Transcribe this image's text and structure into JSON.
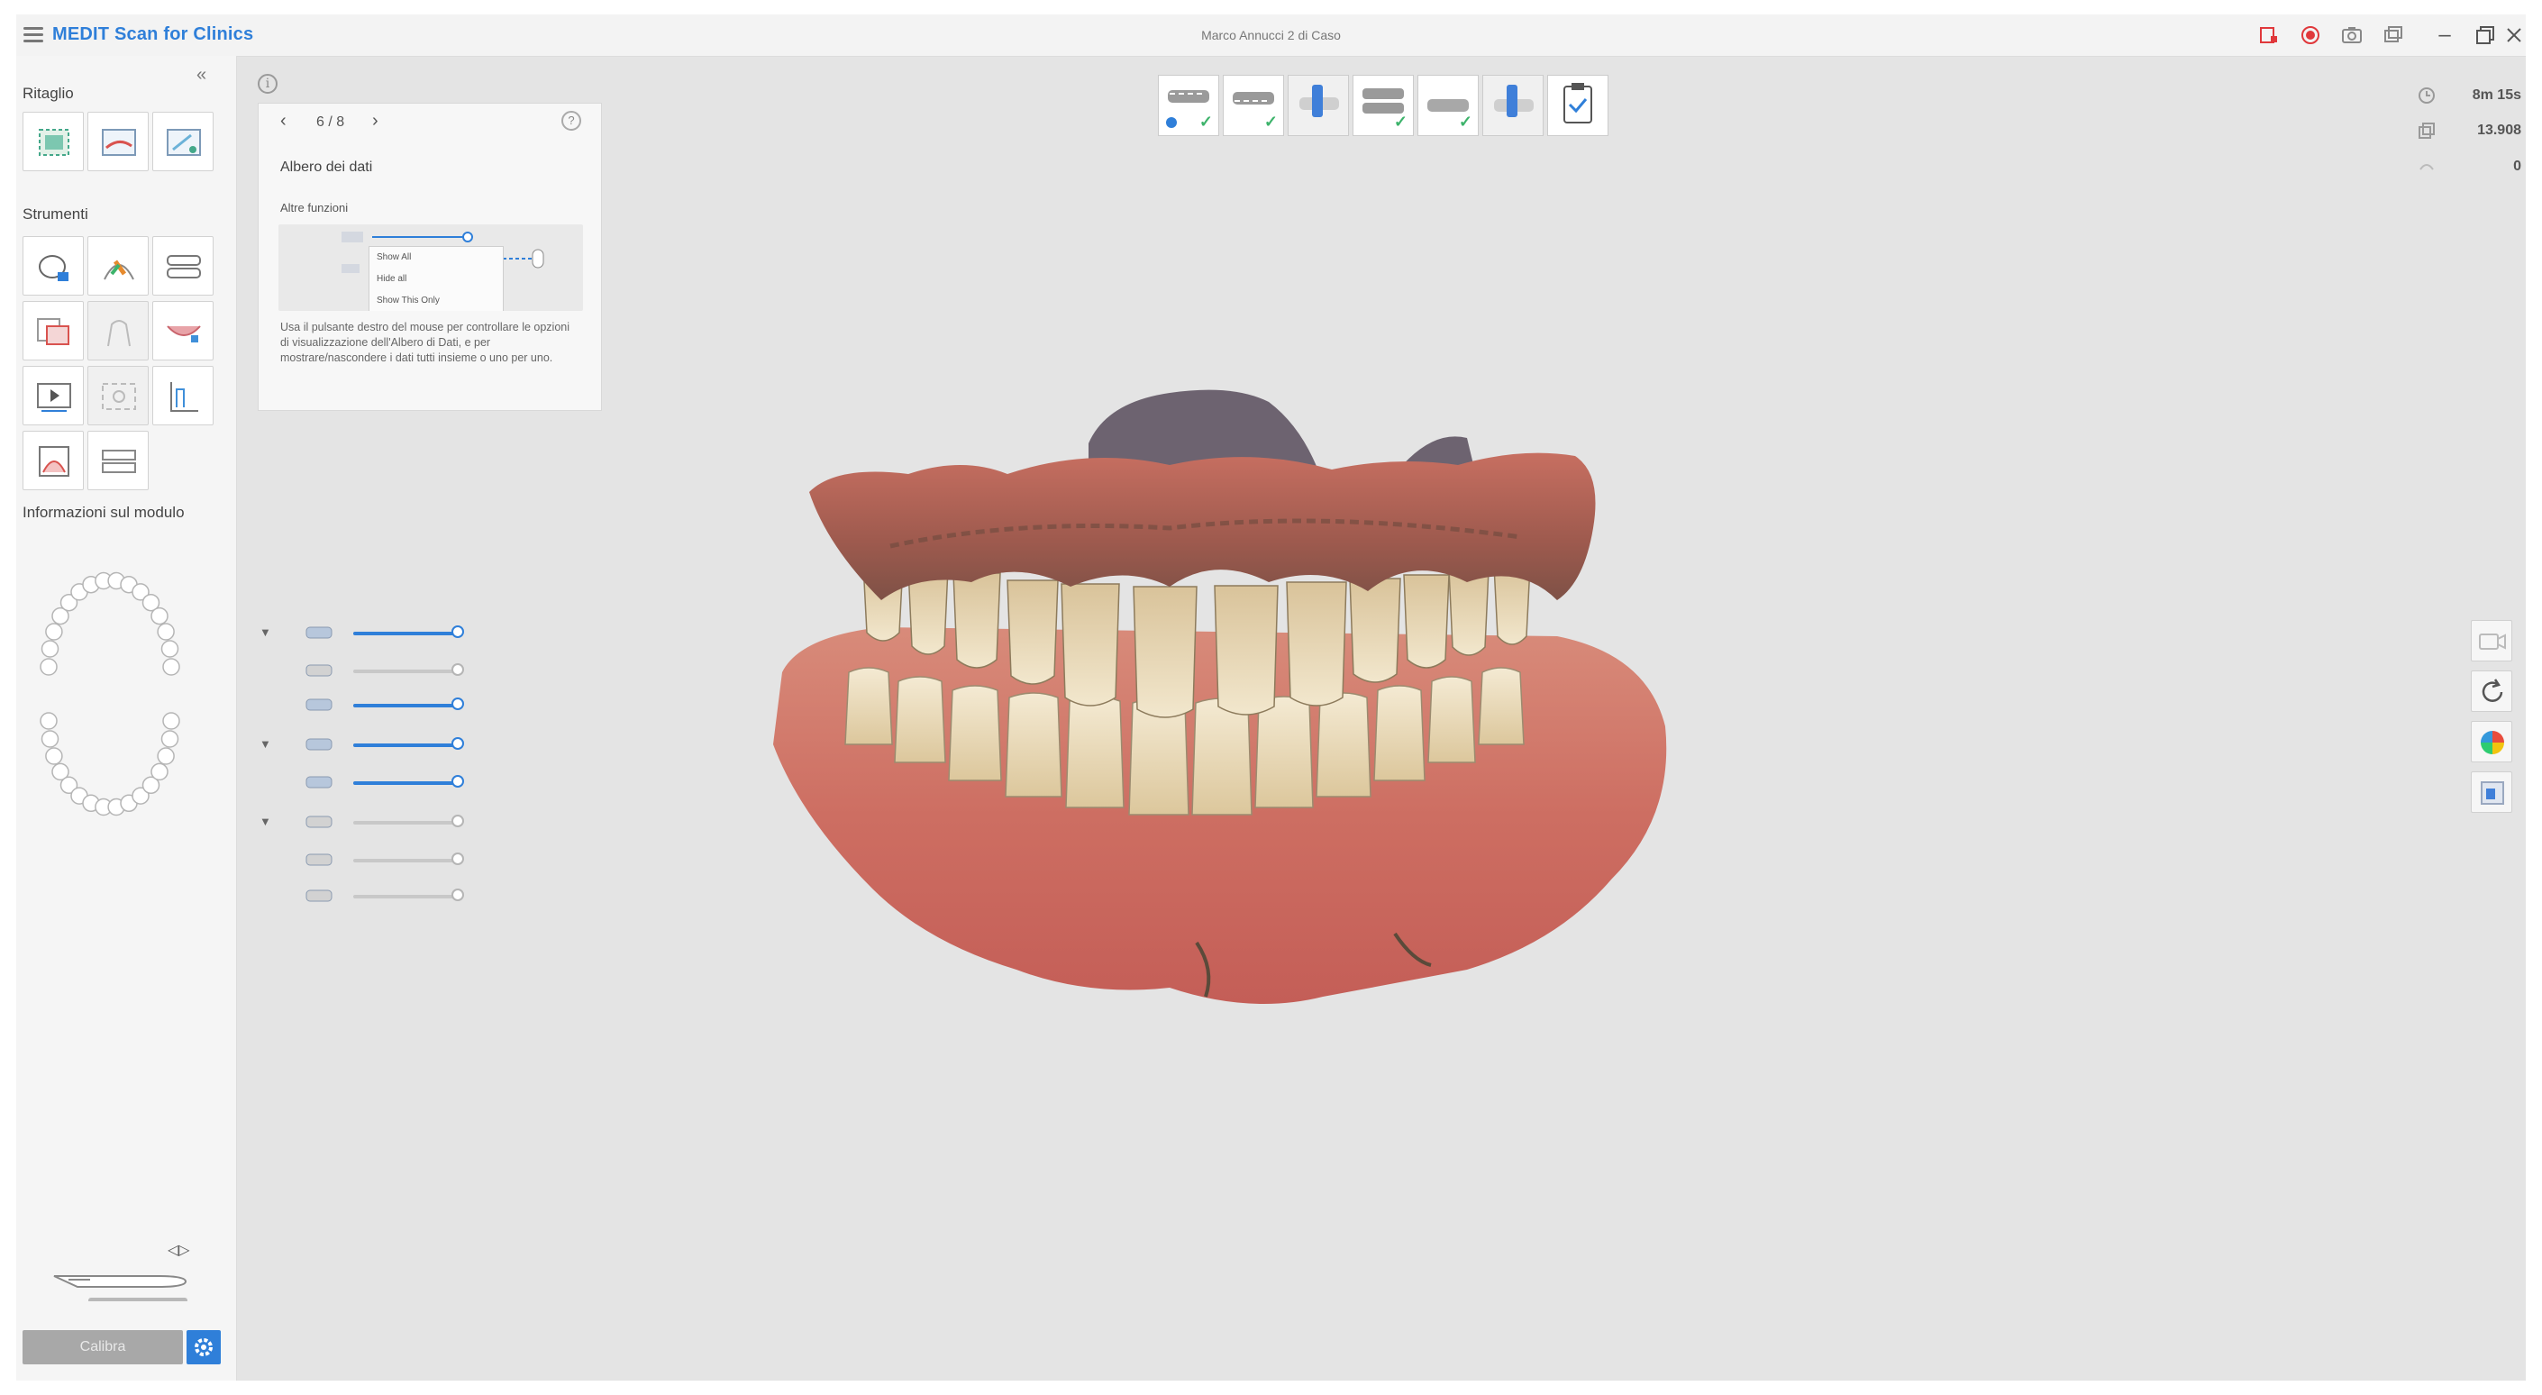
{
  "window": {
    "app_title": "MEDIT Scan for Clinics",
    "case_title": "Marco Annucci 2 di Caso"
  },
  "left_panel": {
    "crop_title": "Ritaglio",
    "tools_title": "Strumenti",
    "module_info_title": "Informazioni sul modulo",
    "calibrate_label": "Calibra",
    "crop_tools": [
      "select-area-icon",
      "plane-cut-icon",
      "lasso-cut-icon"
    ],
    "tools": [
      "lock-area-icon",
      "paint-brush-icon",
      "arch-edit-icon",
      "compare-icon",
      "abutment-icon",
      "bite-icon",
      "play-video-icon",
      "screenshot-icon",
      "measure-icon",
      "occlusion-icon",
      "margin-icon"
    ]
  },
  "help": {
    "counter": "6 / 8",
    "title": "Albero dei dati",
    "subtitle": "Altre funzioni",
    "menu_items": [
      "Show All",
      "Hide all",
      "Show This Only"
    ],
    "description": "Usa il pulsante destro del mouse per controllare le opzioni di visualizzazione dell'Albero di Dati, e per mostrare/nascondere i dati tutti insieme o uno per uno."
  },
  "stages": [
    {
      "icon": "upper-jaw-icon",
      "done": true
    },
    {
      "icon": "lower-jaw-icon",
      "done": true
    },
    {
      "icon": "scan-body-icon",
      "done": false
    },
    {
      "icon": "occlusion-icon",
      "done": true
    },
    {
      "icon": "lower-jaw-alt-icon",
      "done": true
    },
    {
      "icon": "scan-body-alt-icon",
      "done": false
    },
    {
      "icon": "clipboard-check-icon",
      "done": false
    }
  ],
  "stats": {
    "time": "8m 15s",
    "shots": "13.908",
    "frames": "0"
  },
  "data_tree": [
    {
      "expandable": true,
      "value": 1.0
    },
    {
      "expandable": false,
      "value": 0.0
    },
    {
      "expandable": false,
      "value": 1.0
    },
    {
      "expandable": true,
      "value": 1.0
    },
    {
      "expandable": false,
      "value": 1.0
    },
    {
      "expandable": true,
      "value": 0.0
    },
    {
      "expandable": false,
      "value": 0.0
    },
    {
      "expandable": false,
      "value": 0.0
    }
  ],
  "colors": {
    "accent": "#2f7fd9",
    "success": "#3db36b",
    "record": "#e0383b"
  }
}
